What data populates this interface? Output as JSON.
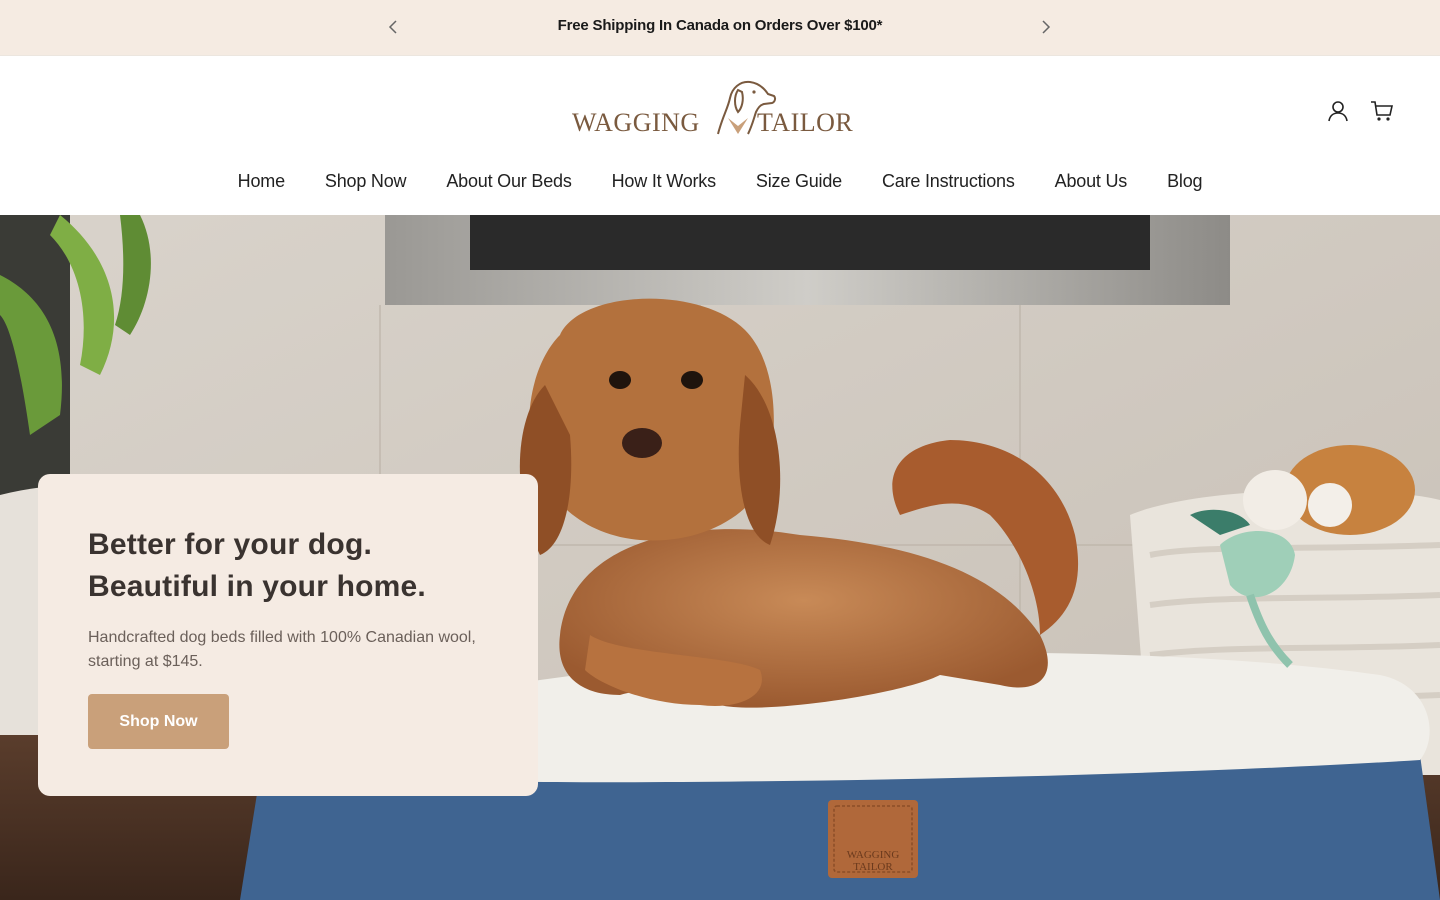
{
  "announcement": {
    "message": "Free Shipping In Canada on Orders Over $100*",
    "prev_icon": "chevron-left-icon",
    "next_icon": "chevron-right-icon"
  },
  "brand": {
    "name_left": "WAGGING",
    "name_right": "TAILOR",
    "color": "#7a5a3f"
  },
  "header": {
    "icons": [
      "account-icon",
      "cart-icon"
    ]
  },
  "nav": {
    "items": [
      "Home",
      "Shop Now",
      "About Our Beds",
      "How It Works",
      "Size Guide",
      "Care Instructions",
      "About Us",
      "Blog"
    ]
  },
  "hero": {
    "heading_line1": "Better for your dog.",
    "heading_line2": "Beautiful in your home.",
    "subtext": "Handcrafted dog beds filled with 100% Canadian wool, starting at $145.",
    "cta_label": "Shop Now",
    "cta_color": "#c9a07a",
    "card_color": "#f5ebe3",
    "bed_label_top": "WAGGING",
    "bed_label_bottom": "TAILOR"
  },
  "colors": {
    "announcement_bg": "#f5ebe2",
    "text_dark": "#3a3330"
  }
}
